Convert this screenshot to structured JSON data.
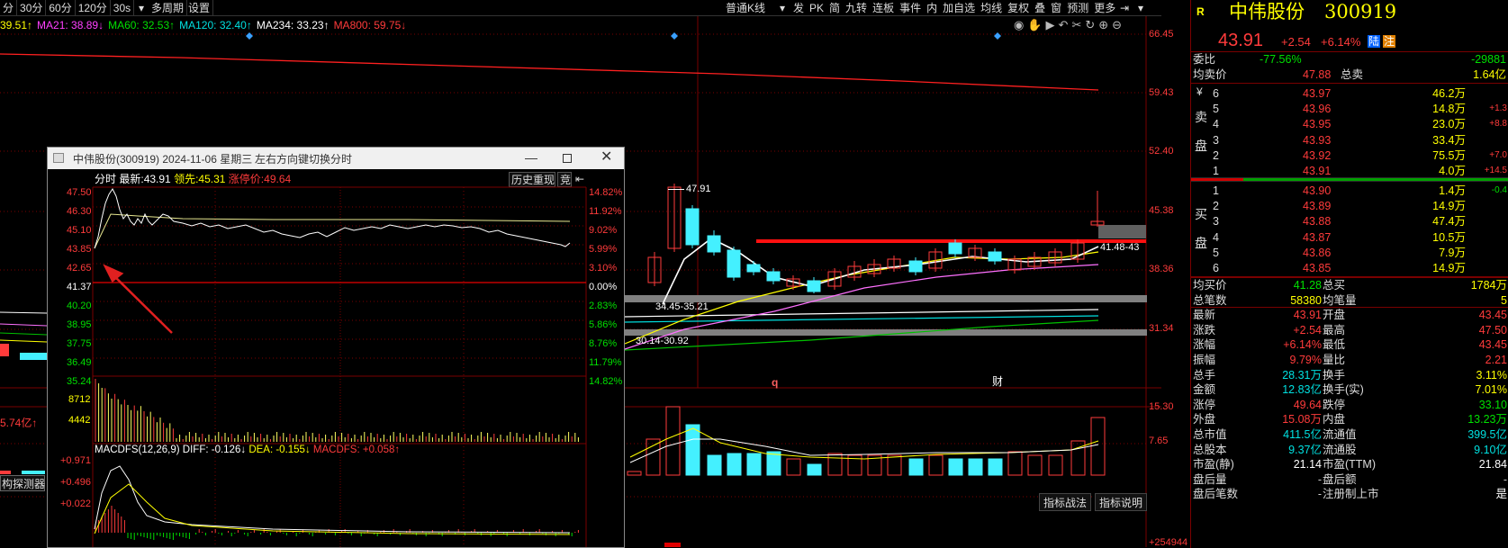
{
  "toolbar": {
    "periods": [
      "分",
      "30分",
      "60分",
      "120分",
      "30s"
    ],
    "multi_period": "多周期",
    "settings": "设置",
    "chart_type": "普通K线",
    "right_buttons": [
      "发",
      "PK",
      "简",
      "九转",
      "连板",
      "事件",
      "内",
      "加自选",
      "均线",
      "复权",
      "叠",
      "窗",
      "预测",
      "更多"
    ]
  },
  "ma_legend": [
    {
      "text": "39.51↑",
      "color": "#ffff00"
    },
    {
      "text": "MA21: 38.89↓",
      "color": "#ff40ff"
    },
    {
      "text": "MA60: 32.53↑",
      "color": "#00e000"
    },
    {
      "text": "MA120: 32.40↑",
      "color": "#00e0e0"
    },
    {
      "text": "MA234: 33.23↑",
      "color": "#ffffff"
    },
    {
      "text": "MA800: 59.75↓",
      "color": "#ff3b3b"
    }
  ],
  "main_price_axis": [
    "66.45",
    "59.43",
    "52.40",
    "45.38",
    "38.36",
    "31.34"
  ],
  "vol_axis": [
    "15.30",
    "7.65"
  ],
  "bottom_axis_partial": "+254944",
  "chart_annotations": {
    "high_label": "47.91",
    "zone1": "34.45-35.21",
    "zone2": "30.14-30.92",
    "line_label": "41.48-43",
    "marker_q": "q",
    "marker_cai": "财"
  },
  "left_fragments": {
    "amount": "5.74亿↑",
    "detector": "构探测器"
  },
  "bottom_buttons": [
    "指标战法",
    "指标说明"
  ],
  "popup": {
    "title": "中伟股份(300919) 2024-11-06 星期三",
    "hint": "左右方向键切换分时",
    "header_mode": "分时",
    "header_latest_label": "最新:",
    "header_latest": "43.91",
    "header_lead_label": "领先:",
    "header_lead": "45.31",
    "header_limit_label": "涨停价:",
    "header_limit": "49.64",
    "replay_button": "历史重现",
    "bid_button": "竞",
    "left_axis": [
      "47.50",
      "46.30",
      "45.10",
      "43.85",
      "42.65",
      "41.37",
      "40.20",
      "38.95",
      "37.75",
      "36.49",
      "35.24"
    ],
    "right_axis": [
      "14.82%",
      "11.92%",
      "9.02%",
      "5.99%",
      "3.10%",
      "0.00%",
      "2.83%",
      "5.86%",
      "8.76%",
      "11.79%",
      "14.82%"
    ],
    "vol_axis": [
      "8712",
      "4442"
    ],
    "macd_title": "MACDFS(12,26,9)",
    "macd_diff": "DIFF: -0.126↓",
    "macd_dea": "DEA: -0.155↓",
    "macd_val": "MACDFS: +0.058↑",
    "macd_axis": [
      "+0.971",
      "+0.496",
      "+0.022"
    ]
  },
  "quote": {
    "r_badge": "R",
    "name": "中伟股份",
    "code": "300919",
    "price": "43.91",
    "change": "+2.54",
    "change_pct": "+6.14%",
    "badge_lu": "陆",
    "badge_zhu": "注",
    "weibi_label": "委比",
    "weibi": "-77.56%",
    "weicha": "-29881",
    "avg_sell_label": "均卖价",
    "avg_sell": "47.88",
    "total_sell_label": "总卖",
    "total_sell": "1.64亿",
    "sell_label": "卖",
    "sell_label2": "盘",
    "buy_label": "买",
    "buy_label2": "盘",
    "yen": "¥",
    "asks": [
      {
        "lvl": "6",
        "price": "43.97",
        "vol": "46.2万",
        "chg": ""
      },
      {
        "lvl": "5",
        "price": "43.96",
        "vol": "14.8万",
        "chg": "+1.3"
      },
      {
        "lvl": "4",
        "price": "43.95",
        "vol": "23.0万",
        "chg": "+8.8"
      },
      {
        "lvl": "3",
        "price": "43.93",
        "vol": "33.4万",
        "chg": ""
      },
      {
        "lvl": "2",
        "price": "43.92",
        "vol": "75.5万",
        "chg": "+7.0"
      },
      {
        "lvl": "1",
        "price": "43.91",
        "vol": "4.0万",
        "chg": "+14.5"
      }
    ],
    "bids": [
      {
        "lvl": "1",
        "price": "43.90",
        "vol": "1.4万",
        "chg": "-0.4"
      },
      {
        "lvl": "2",
        "price": "43.89",
        "vol": "14.9万",
        "chg": ""
      },
      {
        "lvl": "3",
        "price": "43.88",
        "vol": "47.4万",
        "chg": ""
      },
      {
        "lvl": "4",
        "price": "43.87",
        "vol": "10.5万",
        "chg": ""
      },
      {
        "lvl": "5",
        "price": "43.86",
        "vol": "7.9万",
        "chg": ""
      },
      {
        "lvl": "6",
        "price": "43.85",
        "vol": "14.9万",
        "chg": ""
      }
    ],
    "stats": [
      {
        "l1": "均买价",
        "v1": "41.28",
        "c1": "#00e000",
        "l2": "总买",
        "v2": "1784万",
        "c2": "#ffff00"
      },
      {
        "l1": "总笔数",
        "v1": "58380",
        "c1": "#ffff00",
        "l2": "均笔量",
        "v2": "5",
        "c2": "#ffff00"
      },
      {
        "l1": "最新",
        "v1": "43.91",
        "c1": "#ff3b3b",
        "l2": "开盘",
        "v2": "43.45",
        "c2": "#ff3b3b"
      },
      {
        "l1": "涨跌",
        "v1": "+2.54",
        "c1": "#ff3b3b",
        "l2": "最高",
        "v2": "47.50",
        "c2": "#ff3b3b"
      },
      {
        "l1": "涨幅",
        "v1": "+6.14%",
        "c1": "#ff3b3b",
        "l2": "最低",
        "v2": "43.45",
        "c2": "#ff3b3b"
      },
      {
        "l1": "振幅",
        "v1": "9.79%",
        "c1": "#ff3b3b",
        "l2": "量比",
        "v2": "2.21",
        "c2": "#ff3b3b"
      },
      {
        "l1": "总手",
        "v1": "28.31万",
        "c1": "#00e0e0",
        "l2": "换手",
        "v2": "3.11%",
        "c2": "#ffff00"
      },
      {
        "l1": "金额",
        "v1": "12.83亿",
        "c1": "#00e0e0",
        "l2": "换手(实)",
        "v2": "7.01%",
        "c2": "#ffff00"
      },
      {
        "l1": "涨停",
        "v1": "49.64",
        "c1": "#ff3b3b",
        "l2": "跌停",
        "v2": "33.10",
        "c2": "#00e000"
      },
      {
        "l1": "外盘",
        "v1": "15.08万",
        "c1": "#ff3b3b",
        "l2": "内盘",
        "v2": "13.23万",
        "c2": "#00e000"
      },
      {
        "l1": "总市值",
        "v1": "411.5亿",
        "c1": "#00e0e0",
        "l2": "流通值",
        "v2": "399.5亿",
        "c2": "#00e0e0"
      },
      {
        "l1": "总股本",
        "v1": "9.37亿",
        "c1": "#00e0e0",
        "l2": "流通股",
        "v2": "9.10亿",
        "c2": "#00e0e0"
      },
      {
        "l1": "市盈(静)",
        "v1": "21.14",
        "c1": "#ffffff",
        "l2": "市盈(TTM)",
        "v2": "21.84",
        "c2": "#ffffff"
      },
      {
        "l1": "盘后量",
        "v1": "-",
        "c1": "#cccccc",
        "l2": "盘后额",
        "v2": "-",
        "c2": "#cccccc"
      },
      {
        "l1": "盘后笔数",
        "v1": "-",
        "c1": "#cccccc",
        "l2": "注册制上市",
        "v2": "是",
        "c2": "#ffffff"
      }
    ]
  },
  "colors": {
    "up": "#ff3b3b",
    "down": "#44f0ff",
    "grid": "#7a0000"
  }
}
